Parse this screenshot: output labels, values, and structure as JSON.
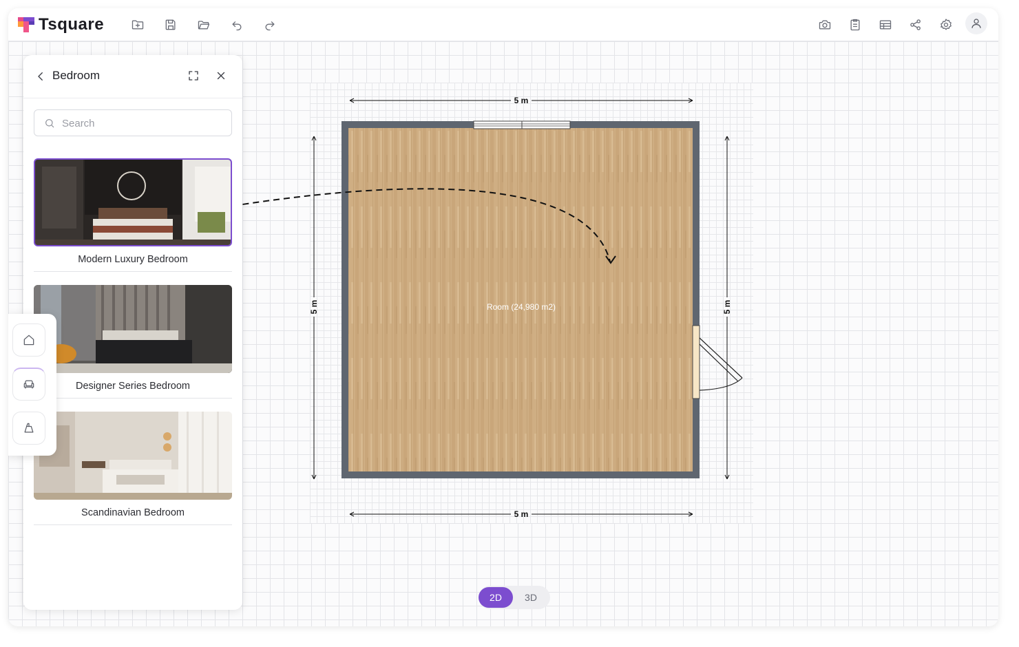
{
  "app": {
    "name": "Tsquare"
  },
  "toolbar": {
    "left_icons": [
      "new-file-icon",
      "save-icon",
      "open-folder-icon",
      "undo-icon",
      "redo-icon"
    ],
    "right_icons": [
      "camera-icon",
      "clipboard-icon",
      "table-icon",
      "share-icon",
      "settings-icon",
      "user-icon"
    ]
  },
  "panel": {
    "title": "Bedroom",
    "search_placeholder": "Search",
    "items": [
      {
        "label": "Modern Luxury Bedroom",
        "selected": true
      },
      {
        "label": "Designer Series Bedroom",
        "selected": false
      },
      {
        "label": "Scandinavian Bedroom",
        "selected": false
      }
    ]
  },
  "side_tools": [
    "home-icon",
    "furniture-icon",
    "wall-icon"
  ],
  "plan": {
    "room_label": "Room (24,980 m2)",
    "dim_top": "5 m",
    "dim_bottom": "5 m",
    "dim_left": "5 m",
    "dim_right": "5 m"
  },
  "view_toggle": {
    "option_2d": "2D",
    "option_3d": "3D",
    "active": "2D"
  },
  "colors": {
    "accent": "#7c4dcf",
    "wall": "#5f6670",
    "floor": "#c9a77b"
  }
}
